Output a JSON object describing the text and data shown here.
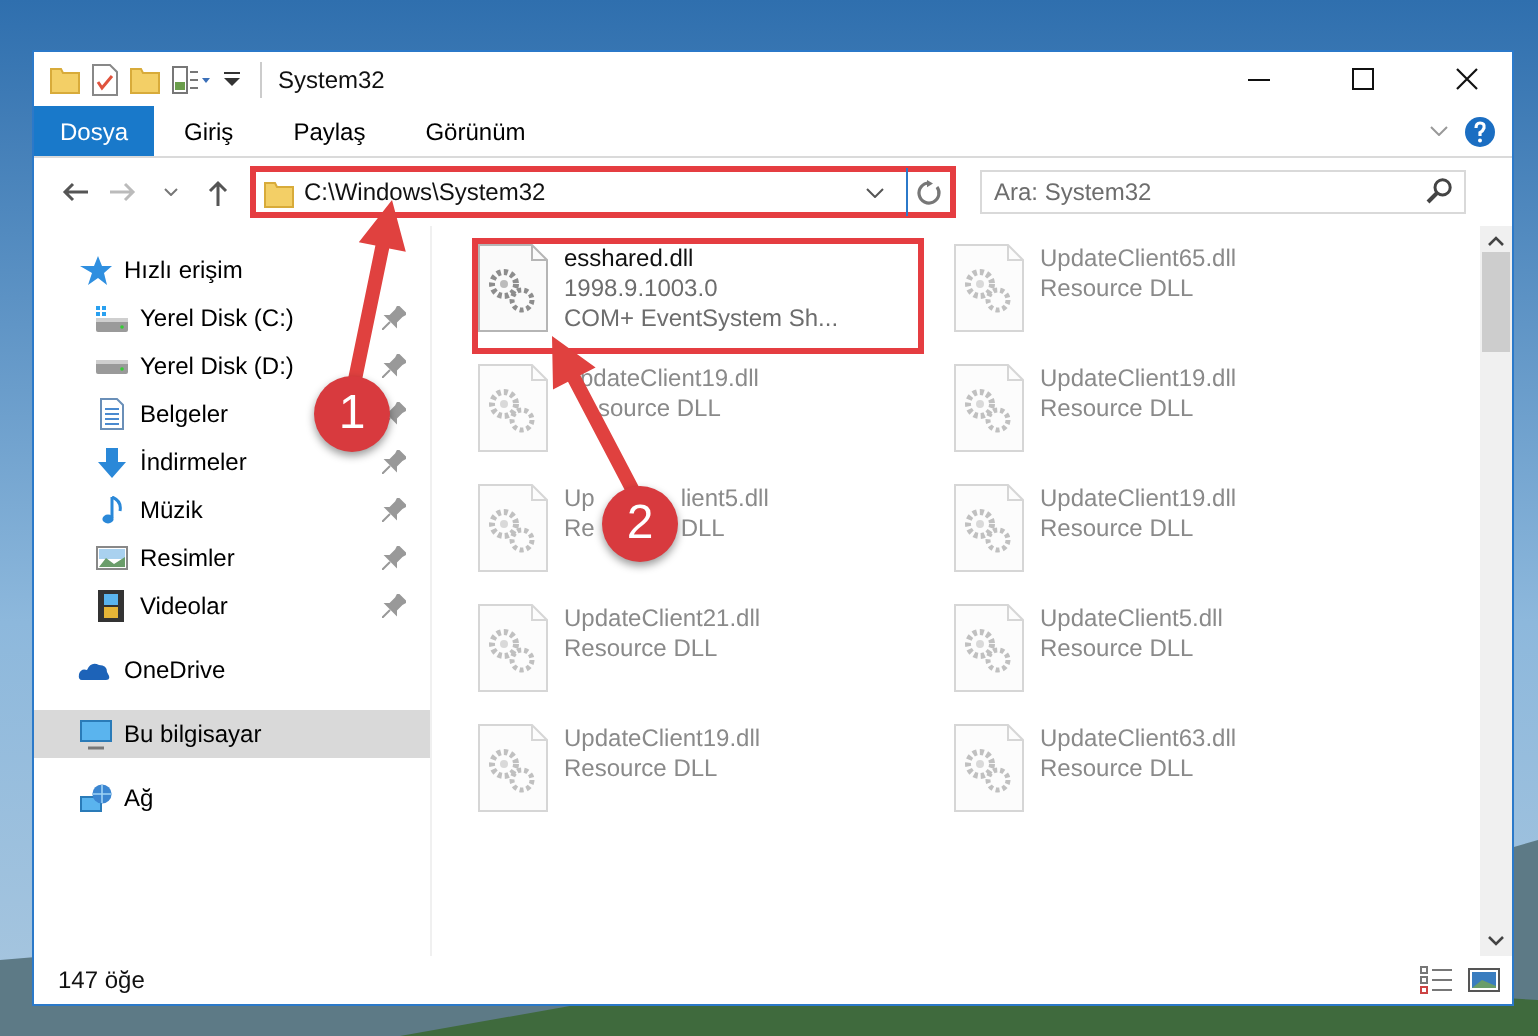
{
  "window": {
    "title": "System32"
  },
  "ribbon": {
    "tabs": [
      {
        "label": "Dosya",
        "kind": "file"
      },
      {
        "label": "Giriş",
        "kind": "tab"
      },
      {
        "label": "Paylaş",
        "kind": "tab"
      },
      {
        "label": "Görünüm",
        "kind": "tab"
      }
    ]
  },
  "address_bar": {
    "path": "C:\\Windows\\System32",
    "highlighted": true
  },
  "search": {
    "placeholder": "Ara: System32"
  },
  "sidebar": {
    "items": [
      {
        "label": "Hızlı erişim",
        "selected": false,
        "children": [
          {
            "label": "Yerel Disk (C:)",
            "selected": false,
            "pinned": true
          },
          {
            "label": "Yerel Disk (D:)",
            "selected": false,
            "pinned": true
          },
          {
            "label": "Belgeler",
            "selected": false,
            "pinned": true
          },
          {
            "label": "İndirmeler",
            "selected": false,
            "pinned": true
          },
          {
            "label": "Müzik",
            "selected": false,
            "pinned": true
          },
          {
            "label": "Resimler",
            "selected": false,
            "pinned": true
          },
          {
            "label": "Videolar",
            "selected": false,
            "pinned": true
          }
        ]
      },
      {
        "label": "OneDrive",
        "selected": false
      },
      {
        "label": "Bu bilgisayar",
        "selected": true
      },
      {
        "label": "Ağ",
        "selected": false
      }
    ]
  },
  "files": [
    {
      "name": "esshared.dll",
      "details": [
        "1998.9.1003.0",
        "COM+ EventSystem Sh..."
      ],
      "highlighted": true
    },
    {
      "name": "pdateClient19.dll",
      "details": [
        "source DLL"
      ],
      "highlighted": false
    },
    {
      "name": "Up",
      "name_end": "lient5.dll",
      "details": [
        "Re"
      ],
      "details_end": [
        "DLL"
      ],
      "highlighted": false
    },
    {
      "name": "UpdateClient21.dll",
      "details": [
        "Resource DLL"
      ],
      "highlighted": false
    },
    {
      "name": "UpdateClient19.dll",
      "details": [
        "Resource DLL"
      ],
      "highlighted": false
    },
    {
      "name": "UpdateClient65.dll",
      "details": [
        "Resource DLL"
      ],
      "highlighted": false
    },
    {
      "name": "UpdateClient19.dll",
      "details": [
        "Resource DLL"
      ],
      "highlighted": false
    },
    {
      "name": "UpdateClient19.dll",
      "details": [
        "Resource DLL"
      ],
      "highlighted": false
    },
    {
      "name": "UpdateClient5.dll",
      "details": [
        "Resource DLL"
      ],
      "highlighted": false
    },
    {
      "name": "UpdateClient63.dll",
      "details": [
        "Resource DLL"
      ],
      "highlighted": false
    }
  ],
  "status_bar": {
    "item_count": "147 öğe"
  },
  "annotations": [
    {
      "label": "1"
    },
    {
      "label": "2"
    }
  ]
}
